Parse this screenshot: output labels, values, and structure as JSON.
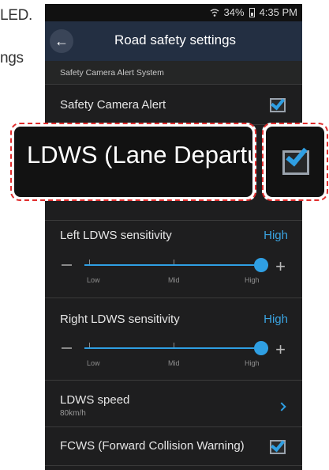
{
  "side_text": {
    "line1": "LED.",
    "line2": "ngs"
  },
  "status_bar": {
    "battery": "34%",
    "time": "4:35 PM"
  },
  "app_bar": {
    "title": "Road safety settings"
  },
  "section": {
    "header": "Safety Camera Alert System"
  },
  "rows": {
    "safety_camera": {
      "label": "Safety Camera Alert",
      "checked": true
    },
    "left_ldws": {
      "label": "Left LDWS sensitivity",
      "value": "High"
    },
    "right_ldws": {
      "label": "Right LDWS sensitivity",
      "value": "High"
    },
    "ldws_speed": {
      "label": "LDWS speed",
      "sub": "80km/h"
    },
    "fcws": {
      "label": "FCWS (Forward Collision Warning)",
      "checked": true
    }
  },
  "slider": {
    "labels": [
      "Low",
      "Mid",
      "High"
    ],
    "left_level": "High",
    "right_level": "High"
  },
  "zoom": {
    "ldws_label": "LDWS (Lane Departur",
    "ldws_checked": true
  },
  "colors": {
    "accent": "#2f9fe3",
    "highlight": "#e02d2d",
    "app_bar": "#232f42"
  }
}
